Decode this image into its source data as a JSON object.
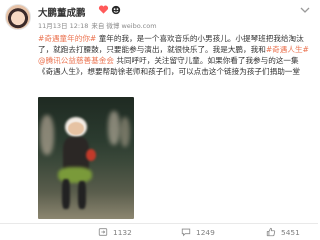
{
  "post": {
    "username": "大鹏董成鹏",
    "timestamp": "11月13日 12:18",
    "source": "来自 微博 weibo.com",
    "content_line1_tag": "#奇遇童年的你#",
    "content_line1_text": " 童年的我，是一个喜欢音乐的小男孩儿。小提琴班把我给淘汰",
    "content_line2": "了，就跑去打腰鼓，只要能参与演出，就很快乐了。我是大鹏，我和",
    "content_line2_tag": "#奇遇人生#",
    "content_line3_mention": "@腾讯公益慈善基金会",
    "content_line3_text": " 共同呼吁，关注留守儿童。如果你看了我参与的这一集",
    "content_line4": "《奇遇人生》，想要帮助徐老师和孩子们，可以点击这个链接为孩子们捐助一堂"
  },
  "icons": {
    "verified_badge": "heart-badge-icon",
    "vip_badge": "vip-badge-icon",
    "more": "chevron-down-icon",
    "repost": "repost-icon",
    "comment": "comment-icon",
    "like": "thumb-up-icon"
  },
  "stats": {
    "reposts": "1132",
    "comments": "1249",
    "likes": "5451"
  },
  "colors": {
    "accent": "#eb7350",
    "username": "#333333",
    "meta": "#8a8a8a"
  }
}
